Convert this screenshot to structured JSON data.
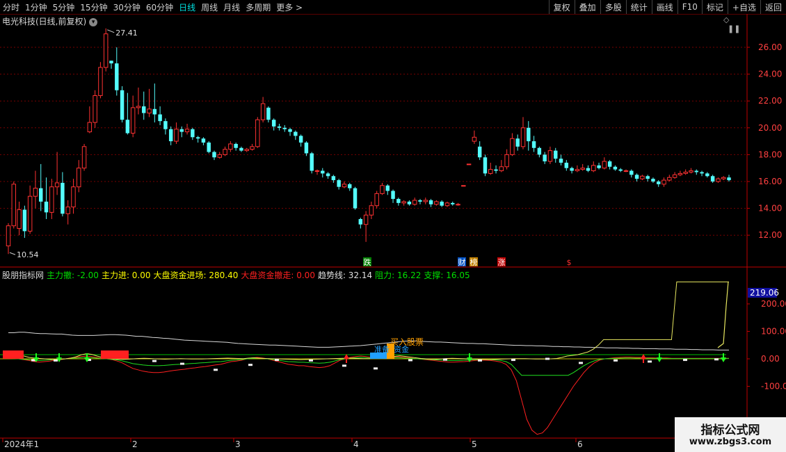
{
  "toolbar": {
    "periods": [
      "分时",
      "1分钟",
      "5分钟",
      "15分钟",
      "30分钟",
      "60分钟",
      "日线",
      "周线",
      "月线",
      "多周期",
      "更多"
    ],
    "active_period": "日线",
    "more_arrow": ">",
    "actions": [
      "复权",
      "叠加",
      "多股",
      "统计",
      "画线",
      "F10",
      "标记",
      "+自选",
      "返回"
    ]
  },
  "stock": {
    "title": "电光科技(日线,前复权)",
    "high_label": "27.41",
    "low_label": "10.54"
  },
  "price_axis": {
    "labels": [
      "26.00",
      "24.00",
      "22.00",
      "20.00",
      "18.00",
      "16.00",
      "14.00",
      "12.00"
    ]
  },
  "event_markers": [
    {
      "text": "跌",
      "color": "#ffffff",
      "bg": "#008000"
    },
    {
      "text": "财",
      "color": "#ffffff",
      "bg": "#0050c0"
    },
    {
      "text": "榜",
      "color": "#ffffff",
      "bg": "#c08000"
    },
    {
      "text": "涨",
      "color": "#ffffff",
      "bg": "#c00000"
    },
    {
      "text": "$",
      "color": "#ff3030",
      "bg": ""
    }
  ],
  "indicator": {
    "name": "股朋指标网",
    "items": [
      {
        "label": "主力撤:",
        "value": "-2.00",
        "color": "#00e000"
      },
      {
        "label": "主力进:",
        "value": "0.00",
        "color": "#ffff00"
      },
      {
        "label": "大盘资金进场:",
        "value": "280.40",
        "color": "#ffff00"
      },
      {
        "label": "大盘资金撤走:",
        "value": "0.00",
        "color": "#ff2020"
      },
      {
        "label": "趋势线:",
        "value": "32.14",
        "color": "#e0e0e0"
      },
      {
        "label": "阻力:",
        "value": "16.22",
        "color": "#00e000"
      },
      {
        "label": "支撑:",
        "value": "16.05",
        "color": "#00e000"
      }
    ],
    "axis_labels": [
      "200.00",
      "100.00",
      "0.00",
      "-100.00"
    ],
    "current_value": "219.06",
    "signal_buy": "买入股票",
    "signal_ready": "准备",
    "signal_fund": "资金"
  },
  "date_axis": {
    "labels": [
      "2024年1",
      "2",
      "3",
      "4",
      "5",
      "6"
    ]
  },
  "watermark": {
    "title": "指标公式网",
    "url": "www.zbgs3.com"
  },
  "colors": {
    "up": "#ff3232",
    "down": "#54fcfc",
    "grid": "#7a0000",
    "axis": "#c00000"
  },
  "chart_data": {
    "type": "candlestick",
    "ylim": [
      11,
      27.6
    ],
    "price_ticks": [
      26,
      24,
      22,
      20,
      18,
      16,
      14,
      12
    ],
    "candles": [
      [
        11.2,
        12.7,
        10.6,
        12.9
      ],
      [
        12.7,
        15.8,
        12.5,
        16.0
      ],
      [
        12.5,
        13.9,
        12.0,
        14.5
      ],
      [
        13.9,
        12.3,
        11.8,
        14.2
      ],
      [
        12.3,
        14.9,
        12.1,
        15.7
      ],
      [
        14.9,
        15.5,
        14.0,
        16.8
      ],
      [
        15.5,
        14.5,
        13.8,
        17.3
      ],
      [
        14.5,
        13.7,
        13.2,
        16.3
      ],
      [
        13.7,
        15.6,
        13.2,
        16.2
      ],
      [
        15.6,
        15.9,
        15.0,
        18.2
      ],
      [
        15.9,
        13.6,
        13.4,
        16.7
      ],
      [
        13.6,
        14.1,
        12.8,
        14.6
      ],
      [
        14.1,
        15.6,
        13.6,
        16.2
      ],
      [
        15.6,
        17.0,
        15.2,
        17.6
      ],
      [
        17.0,
        18.6,
        16.8,
        18.8
      ],
      [
        19.7,
        20.4,
        19.6,
        21.6
      ],
      [
        20.4,
        22.4,
        20.0,
        22.8
      ],
      [
        22.4,
        24.5,
        22.2,
        24.9
      ],
      [
        24.5,
        27.0,
        24.2,
        27.41
      ],
      [
        25.0,
        24.8,
        24.4,
        25.0
      ],
      [
        24.8,
        22.8,
        22.4,
        26.0
      ],
      [
        22.8,
        20.6,
        20.4,
        23.1
      ],
      [
        20.6,
        19.6,
        19.5,
        22.6
      ],
      [
        19.6,
        21.5,
        19.3,
        22.4
      ],
      [
        21.5,
        21.6,
        21.0,
        23.0
      ],
      [
        21.6,
        21.1,
        20.6,
        22.7
      ],
      [
        21.1,
        21.4,
        20.8,
        22.9
      ],
      [
        21.4,
        21.0,
        20.4,
        23.3
      ],
      [
        21.0,
        20.5,
        20.2,
        21.6
      ],
      [
        20.5,
        19.9,
        19.5,
        20.7
      ],
      [
        19.9,
        19.0,
        18.7,
        20.1
      ],
      [
        19.0,
        19.9,
        18.8,
        20.4
      ],
      [
        19.9,
        19.7,
        19.3,
        20.1
      ],
      [
        19.7,
        19.9,
        19.5,
        20.3
      ],
      [
        19.9,
        19.3,
        19.1,
        20.0
      ],
      [
        19.3,
        19.2,
        18.9,
        19.4
      ],
      [
        19.2,
        18.9,
        18.7,
        19.3
      ],
      [
        18.9,
        18.2,
        18.1,
        19.0
      ],
      [
        18.2,
        17.8,
        17.6,
        18.3
      ],
      [
        17.8,
        18.0,
        17.7,
        18.2
      ],
      [
        18.0,
        18.4,
        17.9,
        18.6
      ],
      [
        18.4,
        18.8,
        18.2,
        19.0
      ],
      [
        18.8,
        18.5,
        18.3,
        18.9
      ],
      [
        18.5,
        18.3,
        18.2,
        18.6
      ],
      [
        18.3,
        18.4,
        18.2,
        18.5
      ],
      [
        18.4,
        18.6,
        18.3,
        18.8
      ],
      [
        18.6,
        20.6,
        18.5,
        20.8
      ],
      [
        20.6,
        21.8,
        20.4,
        22.3
      ],
      [
        21.5,
        20.6,
        20.4,
        21.6
      ],
      [
        20.6,
        20.1,
        19.8,
        20.7
      ],
      [
        20.1,
        20.0,
        19.8,
        20.3
      ],
      [
        20.0,
        19.9,
        19.7,
        20.2
      ],
      [
        19.9,
        19.7,
        19.4,
        20.0
      ],
      [
        19.7,
        19.4,
        19.1,
        19.8
      ],
      [
        19.4,
        18.9,
        18.6,
        19.5
      ],
      [
        18.9,
        18.1,
        17.9,
        19.0
      ],
      [
        18.1,
        16.8,
        16.6,
        18.2
      ],
      [
        16.8,
        16.8,
        16.5,
        16.9
      ],
      [
        16.8,
        16.6,
        16.3,
        17.0
      ],
      [
        16.6,
        16.4,
        16.2,
        16.7
      ],
      [
        16.4,
        16.1,
        15.9,
        16.5
      ],
      [
        16.1,
        15.6,
        15.4,
        16.2
      ],
      [
        15.6,
        15.8,
        15.5,
        16.0
      ],
      [
        15.8,
        15.5,
        15.3,
        15.9
      ],
      [
        15.5,
        14.0,
        13.9,
        15.6
      ],
      [
        13.2,
        12.8,
        12.5,
        13.3
      ],
      [
        12.8,
        13.5,
        11.5,
        13.8
      ],
      [
        13.5,
        14.2,
        13.2,
        14.5
      ],
      [
        14.2,
        15.1,
        14.0,
        15.3
      ],
      [
        15.1,
        15.7,
        15.0,
        15.9
      ],
      [
        15.7,
        15.3,
        15.0,
        15.8
      ],
      [
        15.3,
        14.7,
        14.4,
        15.4
      ],
      [
        14.7,
        14.4,
        14.2,
        14.8
      ],
      [
        14.4,
        14.5,
        14.2,
        14.6
      ],
      [
        14.5,
        14.3,
        14.2,
        14.6
      ],
      [
        14.3,
        14.6,
        14.2,
        14.8
      ],
      [
        14.6,
        14.5,
        14.3,
        14.7
      ],
      [
        14.5,
        14.6,
        14.3,
        14.8
      ],
      [
        14.6,
        14.3,
        14.1,
        14.7
      ],
      [
        14.3,
        14.5,
        14.2,
        14.6
      ],
      [
        14.5,
        14.2,
        14.1,
        14.6
      ],
      [
        14.2,
        14.4,
        14.1,
        14.5
      ],
      [
        14.4,
        14.3,
        14.2,
        14.5
      ],
      [
        14.3,
        14.3,
        14.2,
        14.4
      ],
      [
        15.7,
        15.7,
        15.7,
        15.7
      ],
      [
        17.3,
        17.3,
        17.3,
        17.3
      ],
      [
        19.0,
        19.3,
        18.8,
        19.8
      ],
      [
        18.6,
        17.8,
        17.6,
        19.0
      ],
      [
        17.8,
        16.6,
        16.4,
        18.0
      ],
      [
        16.6,
        16.9,
        16.5,
        17.4
      ],
      [
        16.9,
        16.8,
        16.6,
        17.2
      ],
      [
        16.8,
        17.1,
        16.7,
        17.6
      ],
      [
        17.1,
        18.0,
        16.9,
        18.4
      ],
      [
        18.0,
        19.2,
        17.9,
        19.6
      ],
      [
        19.2,
        18.6,
        18.3,
        19.5
      ],
      [
        18.6,
        20.0,
        18.4,
        20.8
      ],
      [
        20.0,
        19.0,
        18.3,
        20.5
      ],
      [
        19.0,
        18.5,
        18.2,
        19.4
      ],
      [
        18.5,
        18.0,
        17.8,
        18.6
      ],
      [
        18.0,
        17.5,
        17.3,
        18.2
      ],
      [
        17.5,
        18.3,
        17.3,
        18.6
      ],
      [
        18.3,
        17.7,
        17.4,
        18.5
      ],
      [
        17.7,
        17.4,
        17.2,
        18.0
      ],
      [
        17.4,
        17.0,
        16.8,
        17.6
      ],
      [
        17.0,
        16.8,
        16.6,
        17.1
      ],
      [
        16.8,
        16.9,
        16.7,
        17.2
      ],
      [
        16.9,
        17.0,
        16.8,
        17.3
      ],
      [
        17.0,
        16.8,
        16.7,
        17.2
      ],
      [
        16.8,
        17.2,
        16.7,
        17.5
      ],
      [
        17.2,
        17.0,
        16.9,
        17.4
      ],
      [
        17.0,
        17.5,
        16.9,
        17.8
      ],
      [
        17.5,
        17.1,
        16.9,
        17.6
      ],
      [
        17.1,
        16.9,
        16.8,
        17.2
      ],
      [
        16.9,
        16.8,
        16.7,
        17.0
      ],
      [
        16.8,
        16.8,
        16.7,
        16.9
      ],
      [
        16.8,
        16.5,
        16.3,
        16.9
      ],
      [
        16.5,
        16.2,
        16.0,
        16.6
      ],
      [
        16.2,
        16.4,
        16.1,
        16.5
      ],
      [
        16.4,
        16.2,
        16.0,
        16.5
      ],
      [
        16.2,
        16.0,
        15.9,
        16.3
      ],
      [
        16.0,
        15.8,
        15.6,
        16.1
      ],
      [
        15.8,
        16.1,
        15.6,
        16.3
      ],
      [
        16.1,
        16.3,
        16.0,
        16.5
      ],
      [
        16.3,
        16.5,
        16.2,
        16.7
      ],
      [
        16.5,
        16.6,
        16.4,
        16.8
      ],
      [
        16.6,
        16.7,
        16.5,
        16.9
      ],
      [
        16.7,
        16.8,
        16.6,
        17.0
      ],
      [
        16.8,
        16.7,
        16.5,
        16.9
      ],
      [
        16.7,
        16.6,
        16.4,
        16.8
      ],
      [
        16.6,
        16.4,
        16.3,
        16.7
      ],
      [
        16.4,
        16.0,
        15.9,
        16.5
      ],
      [
        16.0,
        16.2,
        15.9,
        16.3
      ],
      [
        16.2,
        16.3,
        16.1,
        16.4
      ],
      [
        16.3,
        16.1,
        16.0,
        16.5
      ]
    ],
    "indicator": {
      "ylim": [
        -290,
        290
      ],
      "ticks": [
        200,
        100,
        0,
        -100
      ],
      "trend": [
        95,
        95,
        97,
        97,
        95,
        93,
        92,
        92,
        91,
        90,
        90,
        88,
        86,
        85,
        85,
        85,
        85,
        86,
        87,
        88,
        88,
        87,
        86,
        84,
        82,
        82,
        80,
        78,
        77,
        75,
        74,
        72,
        70,
        68,
        67,
        66,
        65,
        64,
        63,
        62,
        61,
        60,
        58,
        56,
        55,
        54,
        53,
        52,
        51,
        50,
        50,
        49,
        48,
        47,
        46,
        45,
        44,
        43,
        42,
        42,
        42,
        43,
        44,
        45,
        46,
        47,
        48,
        50,
        52,
        54,
        56,
        58,
        60,
        62,
        64,
        65,
        65,
        64,
        63,
        62,
        61,
        61,
        60,
        59,
        58,
        57,
        56,
        56,
        55,
        55,
        54,
        53,
        52,
        51,
        50,
        49,
        49,
        48,
        48,
        47,
        47,
        46,
        45,
        45,
        44,
        44,
        43,
        43,
        42,
        42,
        41,
        41,
        40,
        40,
        40,
        39,
        39,
        38,
        38,
        37,
        37,
        37,
        36,
        36,
        36,
        35,
        35,
        35,
        34,
        34,
        33,
        33,
        33,
        32,
        32,
        32
      ],
      "big_capital": [
        35,
        45,
        50,
        40,
        20,
        10,
        5,
        0,
        -5,
        -10,
        -5,
        0,
        10,
        30,
        60,
        75,
        65,
        40,
        20,
        10,
        0,
        -5,
        -8,
        -5,
        0,
        5,
        8,
        5,
        0,
        -3,
        -5,
        -3,
        0,
        2,
        0,
        -2,
        -3,
        -2,
        0,
        2,
        5,
        8,
        10,
        8,
        5,
        3,
        10,
        15,
        10,
        5,
        3,
        0,
        -2,
        -5,
        -8,
        -10,
        -12,
        -10,
        -8,
        -5,
        -3,
        0,
        2,
        5,
        8,
        10,
        8,
        5,
        3,
        2,
        5,
        8,
        12,
        20,
        35,
        45,
        35,
        25,
        15,
        5,
        0,
        -5,
        -5,
        0,
        5,
        8,
        5,
        2,
        0,
        -2,
        -5,
        -8,
        -10,
        -8,
        -5,
        -3,
        0,
        2,
        3,
        2,
        0,
        -2,
        -3,
        -2,
        0,
        5,
        20,
        40,
        50,
        60,
        80,
        100,
        140,
        200,
        280,
        280,
        280,
        280,
        280,
        280,
        280,
        280,
        280,
        280,
        280,
        280,
        280,
        280,
        280,
        280,
        280,
        280,
        280,
        280,
        280,
        280,
        280,
        280,
        280
      ],
      "short_line": [
        3,
        2,
        0,
        -3,
        -6,
        -10,
        -12,
        -10,
        -8,
        -5,
        -3,
        0,
        3,
        5,
        8,
        10,
        8,
        5,
        2,
        0,
        -3,
        -8,
        -15,
        -25,
        -35,
        -40,
        -45,
        -48,
        -50,
        -50,
        -48,
        -45,
        -42,
        -40,
        -38,
        -35,
        -33,
        -30,
        -28,
        -25,
        -22,
        -20,
        -15,
        -10,
        -8,
        -5,
        0,
        3,
        5,
        3,
        0,
        -5,
        -10,
        -15,
        -20,
        -22,
        -25,
        -25,
        -28,
        -30,
        -32,
        -30,
        -25,
        -15,
        -5,
        0,
        5,
        8,
        10,
        8,
        5,
        3,
        2,
        3,
        5,
        8,
        6,
        4,
        2,
        0,
        -2,
        -4,
        -6,
        -8,
        -10,
        -12,
        -12,
        -11,
        -10,
        -8,
        -6,
        -5,
        -5,
        -6,
        -8,
        -12,
        -20,
        -40,
        -80,
        -150,
        -220,
        -260,
        -275,
        -270,
        -250,
        -220,
        -190,
        -160,
        -130,
        -100,
        -75,
        -50,
        -30,
        -15,
        -5,
        0,
        2,
        4,
        5,
        6,
        6,
        5,
        5,
        4,
        4,
        3,
        3,
        3,
        2,
        2,
        2,
        2,
        2,
        2,
        2,
        2,
        2,
        2,
        2,
        2
      ],
      "dots": [
        {
          "x": 48,
          "y": -5
        },
        {
          "x": 80,
          "y": -6
        },
        {
          "x": 128,
          "y": -4
        },
        {
          "x": 222,
          "y": -8
        },
        {
          "x": 262,
          "y": -18
        },
        {
          "x": 310,
          "y": -40
        },
        {
          "x": 360,
          "y": -22
        },
        {
          "x": 398,
          "y": -4
        },
        {
          "x": 447,
          "y": -6
        },
        {
          "x": 495,
          "y": -25
        },
        {
          "x": 540,
          "y": -35
        },
        {
          "x": 590,
          "y": -5
        },
        {
          "x": 640,
          "y": -3
        },
        {
          "x": 690,
          "y": -6
        },
        {
          "x": 738,
          "y": -4
        },
        {
          "x": 787,
          "y": 0
        },
        {
          "x": 835,
          "y": -15
        },
        {
          "x": 885,
          "y": -6
        },
        {
          "x": 934,
          "y": -10
        },
        {
          "x": 985,
          "y": -4
        },
        {
          "x": 1030,
          "y": -2
        }
      ],
      "green_arrows": [
        52,
        85,
        125,
        675,
        948,
        1040
      ],
      "red_arrows": [
        498,
        925
      ],
      "red_blocks": [
        [
          4,
          34
        ],
        [
          145,
          185
        ]
      ],
      "blue_block": [
        532,
        556
      ],
      "orange_block": [
        556,
        567
      ]
    }
  }
}
